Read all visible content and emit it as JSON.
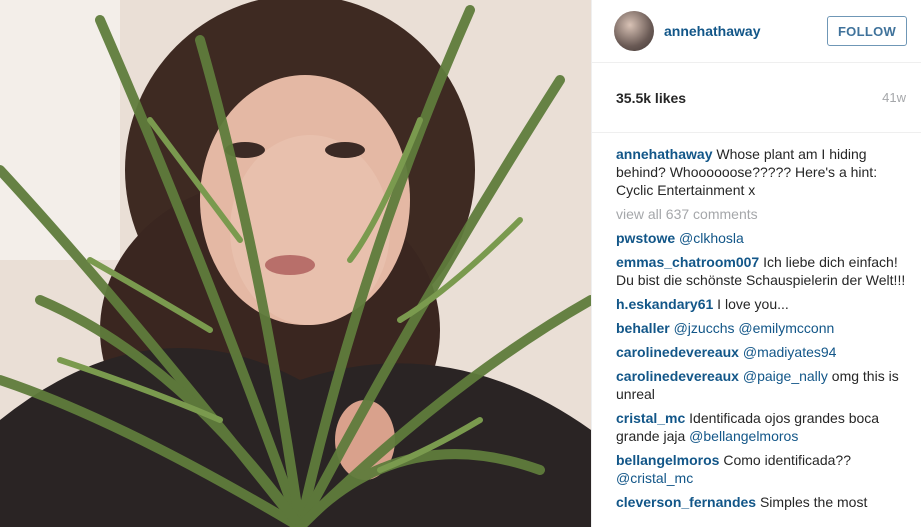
{
  "post": {
    "username": "annehathaway",
    "follow_label": "FOLLOW",
    "likes": "35.5k likes",
    "age": "41w"
  },
  "caption": {
    "username": "annehathaway",
    "text": " Whose plant am I hiding behind? Whoooooose????? Here's a hint: Cyclic Entertainment x"
  },
  "view_all": "view all 637 comments",
  "comments": [
    {
      "user": "pwstowe",
      "parts": [
        {
          "t": " "
        },
        {
          "m": "@clkhosla"
        }
      ]
    },
    {
      "user": "emmas_chatroom007",
      "parts": [
        {
          "t": " Ich liebe dich einfach! Du bist die schönste Schauspielerin der Welt!!!"
        }
      ]
    },
    {
      "user": "h.eskandary61",
      "parts": [
        {
          "t": " I love you..."
        }
      ]
    },
    {
      "user": "behaller",
      "parts": [
        {
          "t": " "
        },
        {
          "m": "@jzucchs"
        },
        {
          "t": " "
        },
        {
          "m": "@emilymcconn"
        }
      ]
    },
    {
      "user": "carolinedevereaux",
      "parts": [
        {
          "t": " "
        },
        {
          "m": "@madiyates94"
        }
      ]
    },
    {
      "user": "carolinedevereaux",
      "parts": [
        {
          "t": " "
        },
        {
          "m": "@paige_nally"
        },
        {
          "t": " omg this is unreal"
        }
      ]
    },
    {
      "user": "cristal_mc",
      "parts": [
        {
          "t": " Identificada ojos grandes boca grande jaja "
        },
        {
          "m": "@bellangelmoros"
        }
      ]
    },
    {
      "user": "bellangelmoros",
      "parts": [
        {
          "t": " Como identificada?? "
        },
        {
          "m": "@cristal_mc"
        }
      ]
    },
    {
      "user": "cleverson_fernandes",
      "parts": [
        {
          "t": " Simples the most"
        }
      ]
    }
  ],
  "colors": {
    "link": "#125688",
    "muted": "#a5a7aa",
    "follow_border": "#6f97b6"
  }
}
